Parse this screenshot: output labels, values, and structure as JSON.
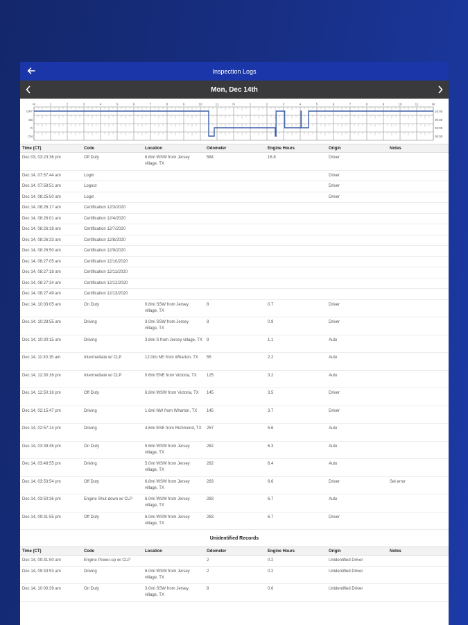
{
  "header": {
    "title": "Inspection Logs"
  },
  "date_nav": {
    "date": "Mon, Dec 14th"
  },
  "graph": {
    "hour_labels": [
      "M",
      "1",
      "2",
      "3",
      "4",
      "5",
      "6",
      "7",
      "8",
      "9",
      "10",
      "11",
      "N",
      "1",
      "2",
      "3",
      "4",
      "5",
      "6",
      "7",
      "8",
      "9",
      "10",
      "11",
      "M"
    ],
    "row_labels": [
      "OFF",
      "SB",
      "D",
      "ON"
    ],
    "totals": [
      "16:00",
      "00:00",
      "03:00",
      "05:00"
    ],
    "segments": [
      {
        "status": "OFF",
        "start": 0,
        "end": 10.5
      },
      {
        "status": "ON",
        "start": 10.5,
        "end": 10.833
      },
      {
        "status": "D",
        "start": 10.833,
        "end": 14.5
      },
      {
        "status": "ON",
        "start": 14.5,
        "end": 14.55
      },
      {
        "status": "OFF",
        "start": 14.55,
        "end": 15.067
      },
      {
        "status": "D",
        "start": 15.067,
        "end": 16.05
      },
      {
        "status": "OFF",
        "start": 16.05,
        "end": 16.06
      },
      {
        "status": "D",
        "start": 16.06,
        "end": 16.5
      },
      {
        "status": "OFF",
        "start": 16.5,
        "end": 24
      }
    ]
  },
  "columns": [
    "Time (CT)",
    "Code",
    "Location",
    "Odometer",
    "Engine Hours",
    "Origin",
    "Notes"
  ],
  "events": [
    {
      "time": "Dec 03, 03:23:36 pm",
      "code": "Off Duty",
      "location": "6.8mi WSW from Jersey village, TX",
      "odometer": "584",
      "hours": "16.8",
      "origin": "Driver",
      "notes": ""
    },
    {
      "time": "Dec 14, 07:57:44 am",
      "code": "Login",
      "location": "",
      "odometer": "",
      "hours": "",
      "origin": "Driver",
      "notes": ""
    },
    {
      "time": "Dec 14, 07:58:51 am",
      "code": "Logout",
      "location": "",
      "odometer": "",
      "hours": "",
      "origin": "Driver",
      "notes": ""
    },
    {
      "time": "Dec 14, 08:25:50 am",
      "code": "Login",
      "location": "",
      "odometer": "",
      "hours": "",
      "origin": "Driver",
      "notes": ""
    },
    {
      "time": "Dec 14, 08:26:17 am",
      "code": "Certification 12/3/2020",
      "location": "",
      "odometer": "",
      "hours": "",
      "origin": "",
      "notes": ""
    },
    {
      "time": "Dec 14, 08:26:01 am",
      "code": "Certification 12/4/2020",
      "location": "",
      "odometer": "",
      "hours": "",
      "origin": "",
      "notes": ""
    },
    {
      "time": "Dec 14, 08:26:18 am",
      "code": "Certification 12/7/2020",
      "location": "",
      "odometer": "",
      "hours": "",
      "origin": "",
      "notes": ""
    },
    {
      "time": "Dec 14, 08:26:33 am",
      "code": "Certification 12/8/2020",
      "location": "",
      "odometer": "",
      "hours": "",
      "origin": "",
      "notes": ""
    },
    {
      "time": "Dec 14, 08:26:50 am",
      "code": "Certification 12/9/2020",
      "location": "",
      "odometer": "",
      "hours": "",
      "origin": "",
      "notes": ""
    },
    {
      "time": "Dec 14, 08:27:05 am",
      "code": "Certification 12/10/2020",
      "location": "",
      "odometer": "",
      "hours": "",
      "origin": "",
      "notes": ""
    },
    {
      "time": "Dec 14, 08:27:18 am",
      "code": "Certification 12/11/2020",
      "location": "",
      "odometer": "",
      "hours": "",
      "origin": "",
      "notes": ""
    },
    {
      "time": "Dec 14, 08:27:34 am",
      "code": "Certification 12/12/2020",
      "location": "",
      "odometer": "",
      "hours": "",
      "origin": "",
      "notes": ""
    },
    {
      "time": "Dec 14, 08:27:49 am",
      "code": "Certification 12/13/2020",
      "location": "",
      "odometer": "",
      "hours": "",
      "origin": "",
      "notes": ""
    },
    {
      "time": "Dec 14, 10:03:05 am",
      "code": "On Duty",
      "location": "0.8mi SSW from Jersey village, TX",
      "odometer": "8",
      "hours": "0.7",
      "origin": "Driver",
      "notes": ""
    },
    {
      "time": "Dec 14, 10:28:55 am",
      "code": "Driving",
      "location": "3.0mi SSW from Jersey village, TX",
      "odometer": "8",
      "hours": "0.9",
      "origin": "Driver",
      "notes": ""
    },
    {
      "time": "Dec 14, 10:30:15 am",
      "code": "Driving",
      "location": "3.8mi S from Jersey village, TX",
      "odometer": "9",
      "hours": "1.1",
      "origin": "Auto",
      "notes": ""
    },
    {
      "time": "Dec 14, 11:30:15 am",
      "code": "Intermediate w/ CLP",
      "location": "12.0mi NE from Wharton, TX",
      "odometer": "55",
      "hours": "2.2",
      "origin": "Auto",
      "notes": ""
    },
    {
      "time": "Dec 14, 12:30:16 pm",
      "code": "Intermediate w/ CLP",
      "location": "0.6mi ENE from Victoria, TX",
      "odometer": "125",
      "hours": "3.2",
      "origin": "Auto",
      "notes": ""
    },
    {
      "time": "Dec 14, 12:50:16 pm",
      "code": "Off Duty",
      "location": "6.8mi WSW from Victoria, TX",
      "odometer": "145",
      "hours": "3.5",
      "origin": "Driver",
      "notes": ""
    },
    {
      "time": "Dec 14, 02:15:47 pm",
      "code": "Driving",
      "location": "1.6mi NW from Wharton, TX",
      "odometer": "145",
      "hours": "3.7",
      "origin": "Driver",
      "notes": ""
    },
    {
      "time": "Dec 14, 02:57:14 pm",
      "code": "Driving",
      "location": "4.6mi ESE from Richmond, TX",
      "odometer": "257",
      "hours": "5.6",
      "origin": "Auto",
      "notes": ""
    },
    {
      "time": "Dec 14, 03:39:45 pm",
      "code": "On Duty",
      "location": "5.6mi WSW from Jersey village, TX",
      "odometer": "282",
      "hours": "6.3",
      "origin": "Auto",
      "notes": ""
    },
    {
      "time": "Dec 14, 03:48:55 pm",
      "code": "Driving",
      "location": "5.0mi WSW from Jersey village, TX",
      "odometer": "282",
      "hours": "6.4",
      "origin": "Auto",
      "notes": ""
    },
    {
      "time": "Dec 14, 03:53:54 pm",
      "code": "Off Duty",
      "location": "6.8mi WSW from Jersey village, TX",
      "odometer": "283",
      "hours": "6.6",
      "origin": "Driver",
      "notes": "Sel error"
    },
    {
      "time": "Dec 14, 03:50:36 pm",
      "code": "Engine Shut-down w/ CLP",
      "location": "6.0mi WSW from Jersey village, TX",
      "odometer": "283",
      "hours": "6.7",
      "origin": "Auto",
      "notes": ""
    },
    {
      "time": "Dec 14, 09:31:55 pm",
      "code": "Off Duty",
      "location": "6.0mi WSW from Jersey village, TX",
      "odometer": "283",
      "hours": "6.7",
      "origin": "Driver",
      "notes": ""
    }
  ],
  "unidentified": {
    "title": "Unidentified Records",
    "records": [
      {
        "time": "Dec 14, 09:31:50 am",
        "code": "Engine Power-up w/ CLP",
        "location": "",
        "odometer": "2",
        "hours": "0.2",
        "origin": "Unidentified Driver",
        "notes": ""
      },
      {
        "time": "Dec 14, 09:33:53 am",
        "code": "Driving",
        "location": "6.0mi WSW from Jersey village, TX",
        "odometer": "2",
        "hours": "0.2",
        "origin": "Unidentified Driver",
        "notes": ""
      },
      {
        "time": "Dec 14, 10:00:39 am",
        "code": "On Duty",
        "location": "3.0mi SSW from Jersey village, TX",
        "odometer": "8",
        "hours": "0.6",
        "origin": "Unidentified Driver",
        "notes": ""
      }
    ]
  },
  "colors": {
    "header_blue": "#1a36a8",
    "date_bar": "#3a3a3c",
    "graph_line": "#3b5fa8"
  }
}
